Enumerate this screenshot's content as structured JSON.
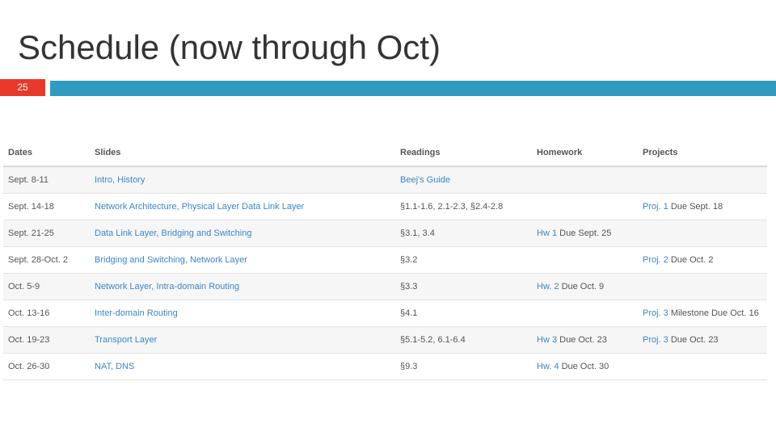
{
  "slide": {
    "title": "Schedule (now through Oct)",
    "page_number": "25",
    "colors": {
      "title_text": "#333333",
      "badge": "#e8392a",
      "accent_bar": "#2e9cc0",
      "link": "#3a86c8"
    }
  },
  "table": {
    "headers": [
      "Dates",
      "Slides",
      "Readings",
      "Homework",
      "Projects"
    ],
    "rows": [
      {
        "dates": "Sept. 8-11",
        "slides": "Intro, History",
        "readings": "Beej's Guide",
        "homework_link": "",
        "homework_due": "",
        "projects_link": "",
        "projects_due": ""
      },
      {
        "dates": "Sept. 14-18",
        "slides": "Network Architecture, Physical Layer Data Link Layer",
        "readings": "§1.1-1.6, 2.1-2.3, §2.4-2.8",
        "homework_link": "",
        "homework_due": "",
        "projects_link": "Proj. 1",
        "projects_due": " Due Sept. 18"
      },
      {
        "dates": "Sept. 21-25",
        "slides": "Data Link Layer, Bridging and Switching",
        "readings": "§3.1, 3.4",
        "homework_link": "Hw 1",
        "homework_due": " Due Sept. 25",
        "projects_link": "",
        "projects_due": ""
      },
      {
        "dates": "Sept. 28-Oct. 2",
        "slides": "Bridging and Switching, Network Layer",
        "readings": "§3.2",
        "homework_link": "",
        "homework_due": "",
        "projects_link": "Proj. 2",
        "projects_due": " Due Oct. 2"
      },
      {
        "dates": "Oct. 5-9",
        "slides": "Network Layer, Intra-domain Routing",
        "readings": "§3.3",
        "homework_link": "Hw. 2",
        "homework_due": " Due Oct. 9",
        "projects_link": "",
        "projects_due": ""
      },
      {
        "dates": "Oct. 13-16",
        "slides": "Inter-domain Routing",
        "readings": "§4.1",
        "homework_link": "",
        "homework_due": "",
        "projects_link": "Proj. 3",
        "projects_due": " Milestone Due Oct. 16"
      },
      {
        "dates": "Oct. 19-23",
        "slides": "Transport Layer",
        "readings": "§5.1-5.2, 6.1-6.4",
        "homework_link": "Hw 3",
        "homework_due": " Due Oct. 23",
        "projects_link": "Proj. 3",
        "projects_due": " Due Oct. 23"
      },
      {
        "dates": "Oct. 26-30",
        "slides": "NAT, DNS",
        "readings": "§9.3",
        "homework_link": "Hw. 4",
        "homework_due": " Due Oct. 30",
        "projects_link": "",
        "projects_due": ""
      }
    ]
  }
}
